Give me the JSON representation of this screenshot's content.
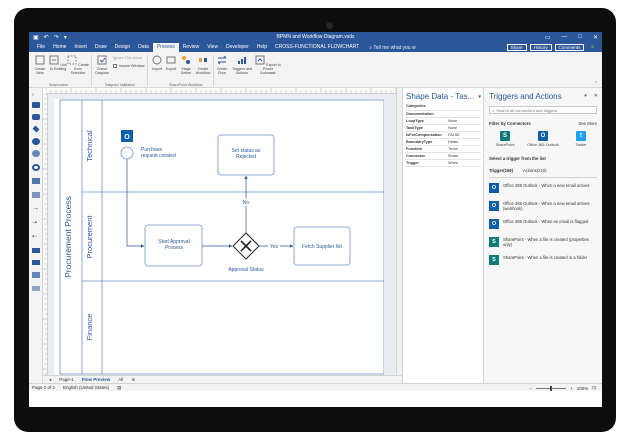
{
  "window": {
    "title": "BPMN and Workflow Diagram.vsdx",
    "controls": [
      "—",
      "□",
      "✕"
    ]
  },
  "menu": {
    "tabs": [
      "File",
      "Home",
      "Insert",
      "Draw",
      "Design",
      "Data",
      "Process",
      "Review",
      "View",
      "Developer",
      "Help",
      "CROSS-FUNCTIONAL FLOWCHART"
    ],
    "active_tab": "Process",
    "tellme": "Tell me what you w",
    "share": "Share",
    "history": "History",
    "comments": "Comments"
  },
  "ribbon": {
    "buttons": {
      "create_new": "Create New",
      "link_existing": "Link to Existing",
      "create_from_selection": "Create from Selection",
      "check_diagram": "Check Diagram",
      "ignore_rule": "Ignore This Issue",
      "issues_window": "Issues Window",
      "import": "Import",
      "export": "Export",
      "stage_define": "Stage Define",
      "create_workflow": "Create Workflow",
      "create_flow": "Create Flow",
      "triggers_actions": "Triggers and Actions",
      "export_power_automate": "Export to Power Automate"
    },
    "groups": {
      "subprocess": "Subprocess",
      "diagram_validation": "Diagram Validation",
      "sharepoint_workflow": "SharePoint Workflow"
    }
  },
  "diagram": {
    "pool": "Procurement Process",
    "lanes": [
      "Technical",
      "Procurement",
      "Finance"
    ],
    "start_event": "Purchase request created",
    "rejected_task": "Set status as Rejected",
    "approval_task": "Start Approval Process",
    "gateway_label": "Approval Status",
    "fetch_task": "Fetch Supplier list",
    "yes_label": "Yes",
    "no_label": "No"
  },
  "shape_data": {
    "title": "Shape Data - Tas...",
    "rows": [
      {
        "k": "Categories",
        "v": ""
      },
      {
        "k": "Documentation",
        "v": ""
      },
      {
        "k": "LoopType",
        "v": "None"
      },
      {
        "k": "TaskType",
        "v": "None"
      },
      {
        "k": "IsForCompensation",
        "v": "FALSE"
      },
      {
        "k": "BoundaryType",
        "v": "Defau"
      },
      {
        "k": "Function",
        "v": "Techn"
      },
      {
        "k": "Connector",
        "v": "Share"
      },
      {
        "k": "Trigger",
        "v": "When"
      }
    ]
  },
  "triggers": {
    "title": "Triggers and Actions",
    "search_placeholder": "Search all connectors and triggers",
    "filter_label": "Filter by Connectors",
    "see_more": "See More",
    "connectors": [
      {
        "name": "SharePoint",
        "color": "#0f7a78",
        "glyph": "S"
      },
      {
        "name": "Office 365 Outlook",
        "color": "#0f5fa8",
        "glyph": "O"
      },
      {
        "name": "Twitter",
        "color": "#1da1f2",
        "glyph": "t"
      }
    ],
    "select_label": "Select a trigger from the list",
    "tab_triggers": "Trigger(169)",
    "tab_actions": "Actions(210)",
    "items": [
      {
        "text": "Office 365 Outlook - When a new email arrives",
        "color": "#0f5fa8",
        "glyph": "O"
      },
      {
        "text": "Office 365 Outlook - When a new email arrives (webhook)",
        "color": "#0f5fa8",
        "glyph": "O"
      },
      {
        "text": "Office 365 Outlook - When an email is flagged",
        "color": "#0f5fa8",
        "glyph": "O"
      },
      {
        "text": "SharePoint - When a file is created (properties only)",
        "color": "#0f7a78",
        "glyph": "S"
      },
      {
        "text": "SharePoint - When a file is created in a folder",
        "color": "#0f7a78",
        "glyph": "S"
      }
    ]
  },
  "page_tabs": {
    "page1": "Page-1",
    "flow_preview": "Flow Preview",
    "all": "All"
  },
  "status": {
    "page": "Page 2 of 2",
    "language": "English (United States)",
    "zoom": "100%"
  }
}
